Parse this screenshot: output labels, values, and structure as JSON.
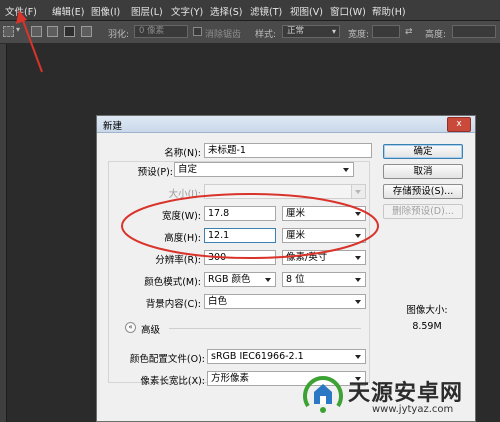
{
  "menubar": {
    "items": [
      "文件(F)",
      "编辑(E)",
      "图像(I)",
      "图层(L)",
      "文字(Y)",
      "选择(S)",
      "滤镜(T)",
      "视图(V)",
      "窗口(W)",
      "帮助(H)"
    ]
  },
  "options_bar": {
    "feather_label": "羽化:",
    "feather_value": "0 像素",
    "antialias_label": "消除锯齿",
    "style_label": "样式:",
    "style_value": "正常",
    "width_label": "宽度:",
    "height_label": "高度:"
  },
  "dialog": {
    "title": "新建",
    "close_symbol": "x",
    "name_label": "名称(N):",
    "name_value": "未标题-1",
    "preset_label": "预设(P):",
    "preset_value": "自定",
    "size_label": "大小(I):",
    "width_label": "宽度(W):",
    "width_value": "17.8",
    "width_unit": "厘米",
    "height_label": "高度(H):",
    "height_value": "12.1",
    "height_unit": "厘米",
    "resolution_label": "分辨率(R):",
    "resolution_value": "300",
    "resolution_unit": "像素/英寸",
    "color_mode_label": "颜色模式(M):",
    "color_mode_value": "RGB 颜色",
    "bit_depth_value": "8 位",
    "background_label": "背景内容(C):",
    "background_value": "白色",
    "advanced_label": "高级",
    "advanced_symbol": "«",
    "color_profile_label": "颜色配置文件(O):",
    "color_profile_value": "sRGB IEC61966-2.1",
    "pixel_aspect_label": "像素长宽比(X):",
    "pixel_aspect_value": "方形像素",
    "ok_label": "确定",
    "cancel_label": "取消",
    "save_preset_label": "存储预设(S)...",
    "delete_preset_label": "删除预设(D)...",
    "image_size_label": "图像大小:",
    "image_size_value": "8.59M"
  },
  "watermark": {
    "title": "天源安卓网",
    "url": "www.jytyaz.com"
  },
  "colors": {
    "annotation_red": "#d9342b",
    "watermark_green": "#3da234",
    "watermark_blue": "#2b78c5"
  }
}
